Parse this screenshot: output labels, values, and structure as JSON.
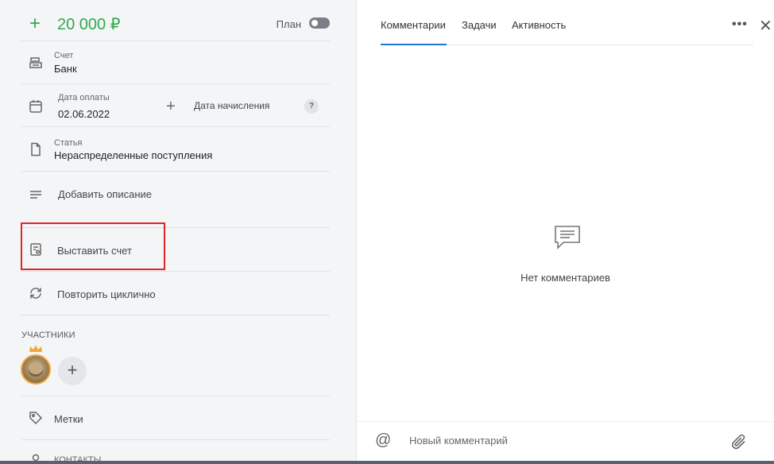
{
  "operation": {
    "amount": "20 000 ₽",
    "plan_label": "План",
    "plan_enabled": false
  },
  "account": {
    "label": "Счет",
    "value": "Банк"
  },
  "payment": {
    "date_label": "Дата оплаты",
    "date_value": "02.06.2022",
    "accrual_label": "Дата начисления",
    "help": "?"
  },
  "category": {
    "label": "Статья",
    "value": "Нераспределенные поступления"
  },
  "actions": {
    "description": "Добавить описание",
    "invoice": "Выставить счет",
    "repeat": "Повторить циклично"
  },
  "participants": {
    "title": "УЧАСТНИКИ"
  },
  "tags": {
    "label": "Метки"
  },
  "contacts": {
    "label": "КОНТАКТЫ"
  },
  "tabs": [
    "Комментарии",
    "Задачи",
    "Активность"
  ],
  "comments": {
    "empty_text": "Нет комментариев",
    "placeholder": "Новый комментарий",
    "at_symbol": "@"
  },
  "colors": {
    "amount": "#2eaa4a",
    "accent": "#1f74d6",
    "highlight": "#e0242a"
  }
}
